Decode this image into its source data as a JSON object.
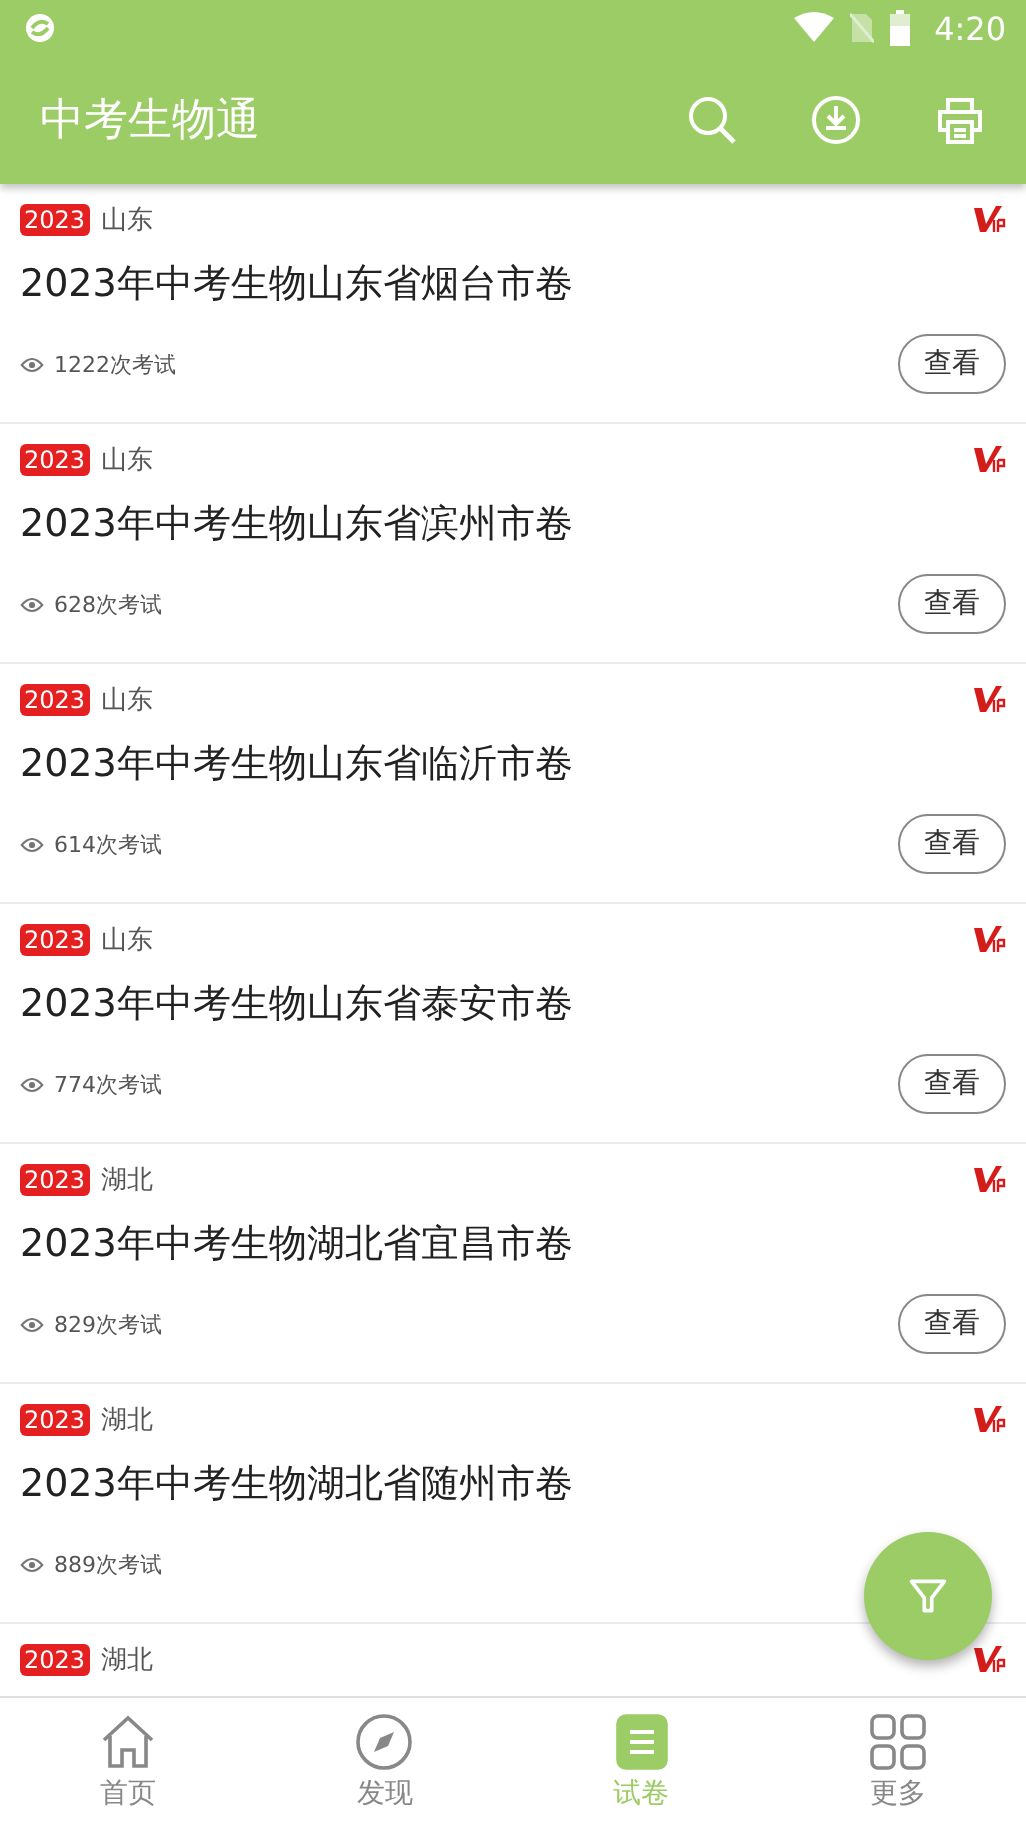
{
  "status_bar": {
    "time": "4:20"
  },
  "app_bar": {
    "title": "中考生物通"
  },
  "papers": [
    {
      "year": "2023",
      "region": "山东",
      "vip": true,
      "title": "2023年中考生物山东省烟台市卷",
      "count": "1222次考试",
      "button": "查看"
    },
    {
      "year": "2023",
      "region": "山东",
      "vip": true,
      "title": "2023年中考生物山东省滨州市卷",
      "count": "628次考试",
      "button": "查看"
    },
    {
      "year": "2023",
      "region": "山东",
      "vip": true,
      "title": "2023年中考生物山东省临沂市卷",
      "count": "614次考试",
      "button": "查看"
    },
    {
      "year": "2023",
      "region": "山东",
      "vip": true,
      "title": "2023年中考生物山东省泰安市卷",
      "count": "774次考试",
      "button": "查看"
    },
    {
      "year": "2023",
      "region": "湖北",
      "vip": true,
      "title": "2023年中考生物湖北省宜昌市卷",
      "count": "829次考试",
      "button": "查看"
    },
    {
      "year": "2023",
      "region": "湖北",
      "vip": true,
      "title": "2023年中考生物湖北省随州市卷",
      "count": "889次考试"
    },
    {
      "year": "2023",
      "region": "湖北",
      "vip": true
    }
  ],
  "bottom_nav": [
    {
      "kind": "home",
      "label": "首页",
      "selected": false
    },
    {
      "kind": "discover",
      "label": "发现",
      "selected": false
    },
    {
      "kind": "papers",
      "label": "试卷",
      "selected": true
    },
    {
      "kind": "more",
      "label": "更多",
      "selected": false
    }
  ]
}
